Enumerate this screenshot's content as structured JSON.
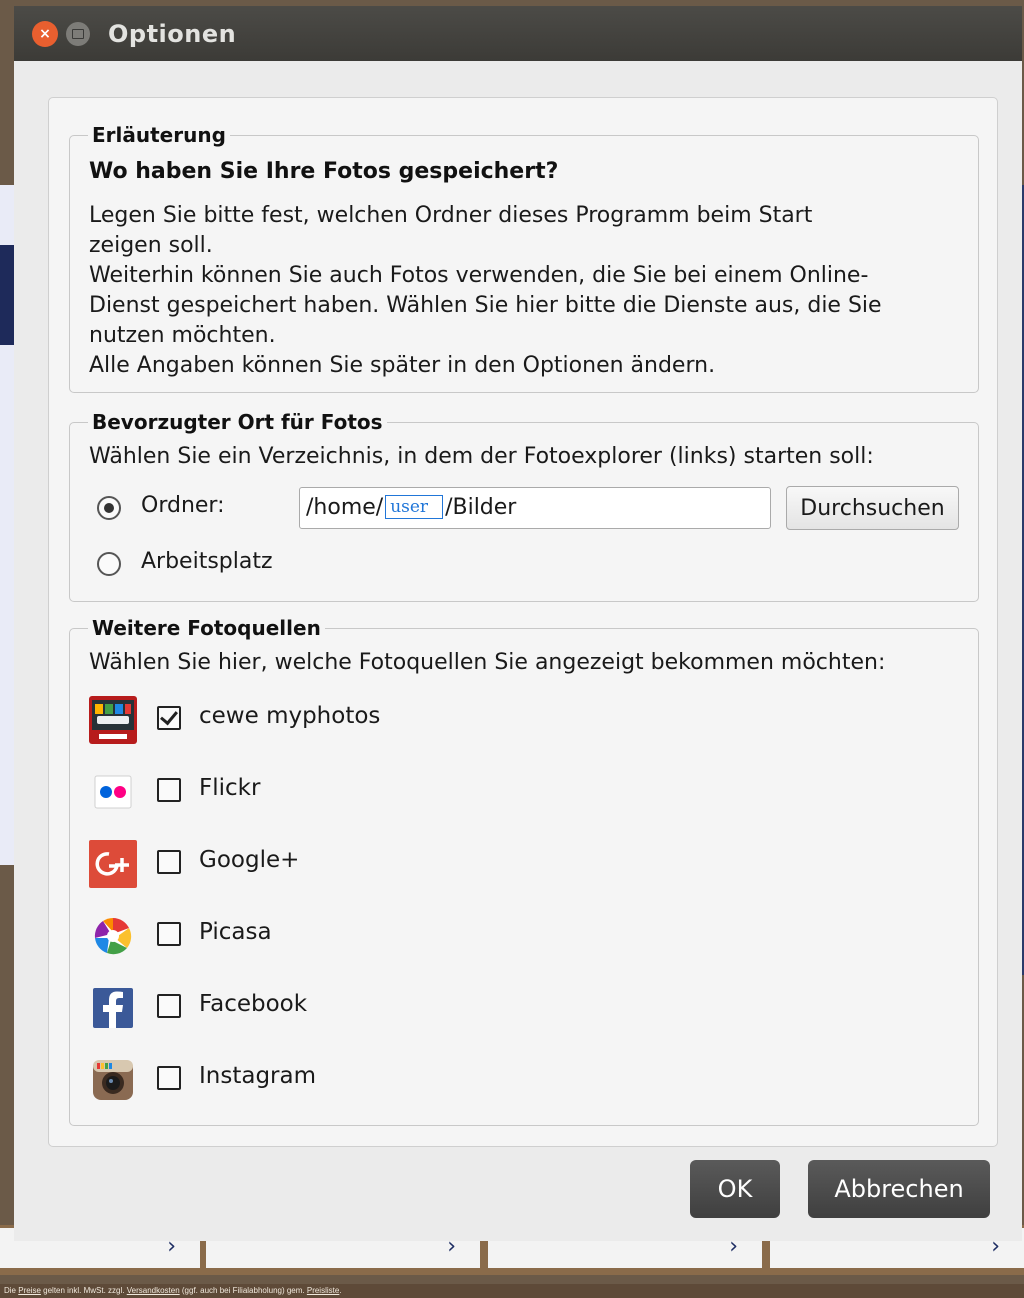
{
  "window": {
    "title": "Optionen",
    "close_glyph": "×"
  },
  "explanation": {
    "legend": "Erläuterung",
    "heading": "Wo haben Sie Ihre Fotos gespeichert?",
    "lines": [
      "Legen Sie bitte fest, welchen Ordner dieses Programm beim Start",
      "zeigen soll.",
      "Weiterhin können Sie auch Fotos verwenden, die Sie bei einem Online-",
      "Dienst gespeichert haben. Wählen Sie hier bitte die Dienste aus, die Sie",
      "nutzen möchten.",
      "Alle Angaben können Sie später in den Optionen ändern."
    ]
  },
  "location": {
    "legend": "Bevorzugter Ort für Fotos",
    "prompt": "Wählen Sie ein Verzeichnis, in dem der Fotoexplorer (links) starten soll:",
    "folder_label": "Ordner:",
    "path_prefix": "/home/",
    "path_user": "user",
    "path_suffix": "/Bilder",
    "browse_label": "Durchsuchen",
    "workspace_label": "Arbeitsplatz",
    "selected": "folder"
  },
  "sources": {
    "legend": "Weitere Fotoquellen",
    "prompt": "Wählen Sie hier, welche Fotoquellen Sie angezeigt bekommen möchten:",
    "items": [
      {
        "label": "cewe myphotos",
        "checked": true,
        "icon": "cewe-myphotos-icon"
      },
      {
        "label": "Flickr",
        "checked": false,
        "icon": "flickr-icon"
      },
      {
        "label": "Google+",
        "checked": false,
        "icon": "google-plus-icon"
      },
      {
        "label": "Picasa",
        "checked": false,
        "icon": "picasa-icon"
      },
      {
        "label": "Facebook",
        "checked": false,
        "icon": "facebook-icon"
      },
      {
        "label": "Instagram",
        "checked": false,
        "icon": "instagram-icon"
      }
    ]
  },
  "buttons": {
    "ok": "OK",
    "cancel": "Abbrechen"
  },
  "background": {
    "chevron": "›",
    "footer_parts": [
      "Die ",
      "Preise",
      " gelten inkl. MwSt. zzgl. ",
      "Versandkosten",
      " (ggf. auch bei Filialabholung) gem. ",
      "Preisliste",
      "."
    ]
  },
  "colors": {
    "titlebar": "#3c3b37",
    "close": "#e95f2f",
    "accent_user": "#2176d8",
    "button_dark": "#4a4a4a"
  }
}
